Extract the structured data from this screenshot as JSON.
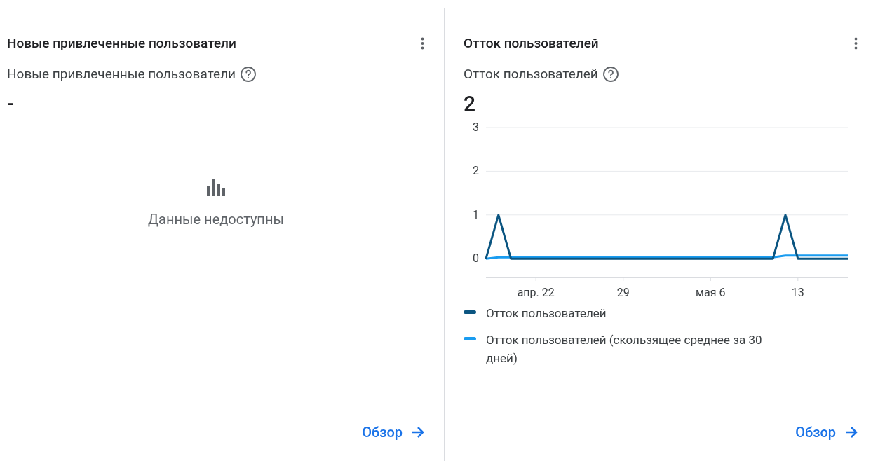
{
  "cards": [
    {
      "title": "Новые привлеченные пользователи",
      "metric_label": "Новые привлеченные пользователи",
      "value": "-",
      "empty_message": "Данные недоступны",
      "link": "Обзор"
    },
    {
      "title": "Отток пользователей",
      "metric_label": "Отток пользователей",
      "value": "2",
      "chart_data": {
        "type": "line",
        "categories": [
          null,
          null,
          null,
          null,
          "апр. 22",
          null,
          null,
          null,
          null,
          null,
          null,
          "29",
          null,
          null,
          null,
          null,
          null,
          null,
          "мая 6",
          null,
          null,
          null,
          null,
          null,
          null,
          "13",
          null,
          null,
          null,
          null
        ],
        "series": [
          {
            "name": "Отток пользователей",
            "color": "#0b5581",
            "values": [
              0,
              1,
              0,
              0,
              0,
              0,
              0,
              0,
              0,
              0,
              0,
              0,
              0,
              0,
              0,
              0,
              0,
              0,
              0,
              0,
              0,
              0,
              0,
              0,
              1,
              0,
              0,
              0,
              0,
              0
            ]
          },
          {
            "name": "Отток пользователей (скользящее среднее за 30 дней)",
            "color": "#1a9cf0",
            "values": [
              0,
              0.03,
              0.03,
              0.03,
              0.03,
              0.03,
              0.03,
              0.03,
              0.03,
              0.03,
              0.03,
              0.03,
              0.03,
              0.03,
              0.03,
              0.03,
              0.03,
              0.03,
              0.03,
              0.03,
              0.03,
              0.03,
              0.03,
              0.03,
              0.07,
              0.07,
              0.07,
              0.07,
              0.07,
              0.07
            ]
          }
        ],
        "ylim": [
          -0.43,
          3
        ],
        "yticks": [
          0,
          1,
          2,
          3
        ],
        "grid": true
      },
      "link": "Обзор"
    }
  ]
}
